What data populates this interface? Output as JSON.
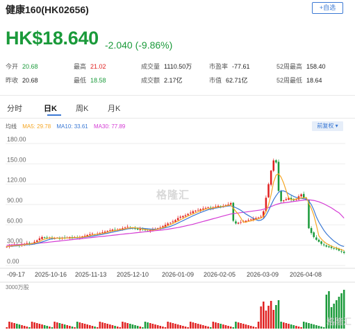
{
  "header": {
    "title": "健康160(HK02656)",
    "add_watchlist": "+自选"
  },
  "quote": {
    "price": "HK$18.640",
    "change": "-2.040  (-9.86%)"
  },
  "stats": [
    {
      "label": "今开",
      "value": "20.68",
      "tone": "down"
    },
    {
      "label": "最高",
      "value": "21.02",
      "tone": "up"
    },
    {
      "label": "成交量",
      "value": "1110.50万",
      "tone": "neutral"
    },
    {
      "label": "市盈率",
      "value": "-77.61",
      "tone": "neutral"
    },
    {
      "label": "52周最高",
      "value": "158.40",
      "tone": "neutral"
    },
    {
      "label": "昨收",
      "value": "20.68",
      "tone": "neutral"
    },
    {
      "label": "最低",
      "value": "18.58",
      "tone": "down"
    },
    {
      "label": "成交额",
      "value": "2.17亿",
      "tone": "neutral"
    },
    {
      "label": "市值",
      "value": "62.71亿",
      "tone": "neutral"
    },
    {
      "label": "52周最低",
      "value": "18.64",
      "tone": "neutral"
    }
  ],
  "tabs": [
    {
      "label": "分时"
    },
    {
      "label": "日K"
    },
    {
      "label": "周K"
    },
    {
      "label": "月K"
    }
  ],
  "ma": {
    "label": "均线",
    "ma5": "MA5: 29.78",
    "ma10": "MA10: 33.61",
    "ma30": "MA30: 77.89",
    "adjust": "前复权 ▾"
  },
  "watermark": "格隆汇",
  "volume_label": "3000万股",
  "colors": {
    "up": "#e02020",
    "down": "#1a9a3a",
    "ma5": "#f5a623",
    "ma10": "#3a78d4",
    "ma30": "#d43ad4",
    "accent": "#3a78d4"
  },
  "chart_data": {
    "type": "candlestick",
    "y_ticks": [
      "180.00",
      "150.00",
      "120.00",
      "90.00",
      "60.00",
      "30.00",
      "0.00"
    ],
    "ylim": [
      0,
      180
    ],
    "x_ticks": [
      "-09-17",
      "2025-10-16",
      "2025-11-13",
      "2025-12-10",
      "2026-01-09",
      "2026-02-05",
      "2026-03-09",
      "2026-04-08"
    ],
    "close": [
      28,
      29,
      30,
      31,
      30,
      29,
      31,
      32,
      33,
      32,
      33,
      35,
      37,
      40,
      42,
      41,
      40,
      41,
      40,
      40,
      41,
      40,
      41,
      40,
      41,
      42,
      41,
      42,
      41,
      42,
      43,
      44,
      45,
      46,
      47,
      46,
      47,
      48,
      49,
      50,
      51,
      52,
      53,
      52,
      53,
      54,
      55,
      56,
      57,
      56,
      55,
      54,
      53,
      54,
      53,
      52,
      51,
      52,
      53,
      54,
      55,
      56,
      58,
      60,
      62,
      63,
      65,
      67,
      70,
      72,
      73,
      74,
      76,
      78,
      80,
      81,
      82,
      83,
      84,
      85,
      86,
      84,
      86,
      87,
      88,
      87,
      88,
      89,
      90,
      92,
      66,
      62,
      63,
      64,
      65,
      66,
      67,
      68,
      69,
      70,
      71,
      72,
      80,
      100,
      120,
      140,
      155,
      152,
      110,
      95,
      96,
      98,
      100,
      97,
      96,
      98,
      102,
      105,
      100,
      97,
      55,
      48,
      42,
      38,
      35,
      32,
      30,
      28,
      27,
      26,
      25,
      24,
      22,
      20.68,
      18.64
    ],
    "ma5": [
      28,
      28.5,
      29,
      29.5,
      29.8,
      30,
      30.2,
      30.8,
      31.3,
      31.6,
      32.3,
      33,
      34,
      35.4,
      37.4,
      39,
      40,
      40.8,
      40.8,
      40.4,
      40.4,
      40.4,
      40.4,
      40.4,
      40.6,
      40.8,
      41,
      41.2,
      41.4,
      41.6,
      41.8,
      42.4,
      43,
      44,
      45,
      45.6,
      46.2,
      46.8,
      47.4,
      48,
      49,
      50,
      51,
      51.6,
      52.2,
      52.8,
      53.4,
      54,
      55,
      55.6,
      55.8,
      55.6,
      55,
      54.4,
      53.8,
      53.2,
      52.6,
      52.4,
      52.2,
      52.8,
      53.6,
      54.6,
      55.8,
      57,
      58.8,
      60.4,
      62,
      63.8,
      65.6,
      67.4,
      69.4,
      71.2,
      73,
      74.8,
      76.2,
      77.8,
      79.4,
      80.8,
      82,
      83,
      84,
      84.4,
      85,
      85.6,
      86.2,
      86.6,
      87.2,
      87.8,
      88.8,
      89.2,
      84.6,
      80,
      75.8,
      70,
      64,
      64,
      65,
      66,
      67,
      68,
      69,
      70,
      72.4,
      79.6,
      89.6,
      104,
      123,
      133.4,
      135.4,
      130.4,
      121.6,
      110.6,
      99.8,
      97.2,
      97.4,
      98.2,
      99.6,
      99.6,
      99.8,
      100.4,
      92,
      84.2,
      74.4,
      60,
      43.6,
      39,
      35.4,
      32.6,
      30.6,
      28.6,
      27.2,
      26,
      24.8,
      23.3,
      22.1
    ],
    "ma10": [
      28,
      28.2,
      28.5,
      28.8,
      29,
      29.5,
      30,
      30.3,
      30.6,
      30.9,
      31.2,
      31.8,
      32.5,
      33.5,
      34.8,
      36,
      37.4,
      38.6,
      39.6,
      40,
      40.4,
      40.6,
      40.6,
      40.6,
      40.6,
      40.6,
      40.6,
      40.8,
      41,
      41.2,
      41.4,
      41.8,
      42.3,
      42.8,
      43.4,
      44,
      44.6,
      45.3,
      46,
      46.8,
      47.6,
      48.4,
      49.2,
      50,
      50.8,
      51.6,
      52.4,
      53.2,
      54,
      54.6,
      55,
      55.2,
      55.2,
      55,
      54.8,
      54.6,
      54.2,
      53.8,
      53.6,
      53.6,
      53.8,
      54.2,
      54.8,
      55.6,
      56.6,
      57.8,
      59.2,
      60.8,
      62.6,
      64.4,
      66.2,
      68,
      69.8,
      71.6,
      73.4,
      75,
      76.6,
      78.2,
      79.6,
      81,
      82.2,
      83.2,
      84,
      84.8,
      85.4,
      86,
      86.6,
      87.2,
      87.8,
      88.2,
      87,
      85.4,
      83.6,
      81.4,
      78.8,
      76,
      73.8,
      71.6,
      69.4,
      67.6,
      66.4,
      67,
      69.2,
      74,
      81,
      89,
      97,
      103,
      108,
      110,
      110,
      108.5,
      106,
      104,
      102,
      100.5,
      99.5,
      99,
      98.5,
      98,
      95,
      90,
      82,
      72,
      64,
      58,
      52,
      47,
      43,
      39.5,
      36,
      33.61,
      31,
      29,
      28
    ],
    "ma30": [
      30,
      30.2,
      30.4,
      30.6,
      30.8,
      31,
      31.2,
      31.4,
      31.6,
      31.8,
      32,
      32.3,
      32.6,
      33,
      33.4,
      33.8,
      34.2,
      34.6,
      35,
      35.4,
      35.8,
      36.2,
      36.6,
      37,
      37.4,
      37.8,
      38.2,
      38.6,
      39,
      39.4,
      39.8,
      40.2,
      40.6,
      41,
      41.4,
      41.8,
      42.2,
      42.6,
      43,
      43.4,
      43.8,
      44.2,
      44.6,
      45,
      45.4,
      45.8,
      46.2,
      46.6,
      47,
      47.4,
      47.8,
      48.2,
      48.6,
      49,
      49.4,
      49.8,
      50.2,
      50.6,
      51,
      51.4,
      51.8,
      52.2,
      52.6,
      53,
      53.6,
      54.2,
      54.8,
      55.4,
      56,
      56.8,
      57.6,
      58.4,
      59.2,
      60,
      61,
      62,
      63,
      64,
      65,
      66,
      67,
      68,
      69,
      70,
      71,
      72,
      73,
      74,
      75,
      76,
      76.5,
      77,
      77.5,
      78,
      78.5,
      79,
      79.5,
      80,
      80.5,
      81,
      81.5,
      82,
      83,
      84,
      85.5,
      87,
      88.5,
      90,
      91,
      92,
      92.5,
      93,
      93.5,
      94,
      94.5,
      95,
      95.5,
      96,
      96.5,
      97,
      97,
      96.5,
      96,
      95,
      94,
      92.5,
      91,
      89,
      87,
      85,
      82.5,
      80,
      77.89,
      74,
      70
    ]
  }
}
